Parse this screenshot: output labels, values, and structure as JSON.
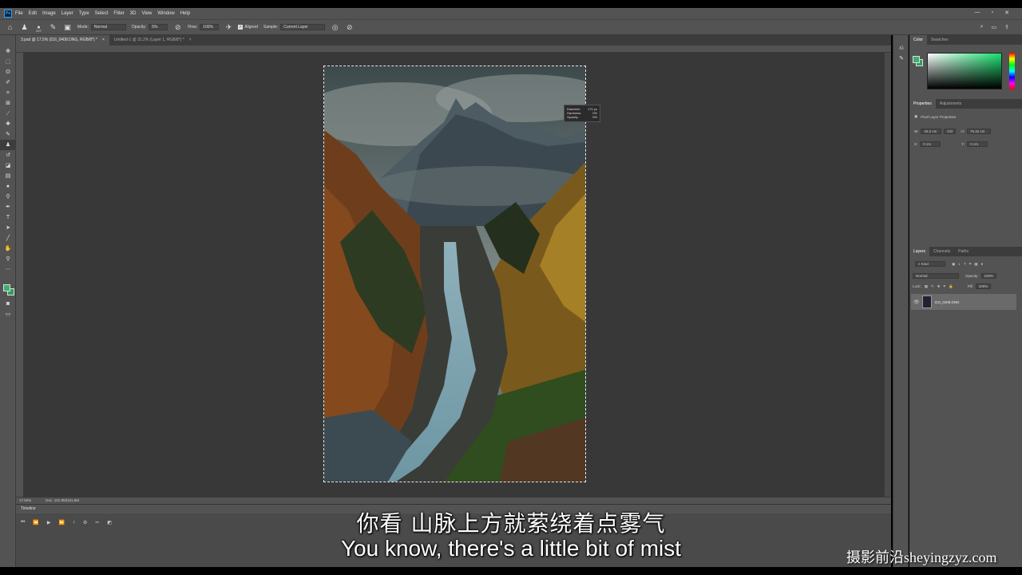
{
  "app": {
    "logo": "Ps"
  },
  "menu": [
    "File",
    "Edit",
    "Image",
    "Layer",
    "Type",
    "Select",
    "Filter",
    "3D",
    "View",
    "Window",
    "Help"
  ],
  "window_controls": [
    "—",
    "▫",
    "✕"
  ],
  "options": {
    "brush_size": "227",
    "mode_label": "Mode:",
    "mode_value": "Normal",
    "opacity_label": "Opacity:",
    "opacity_value": "5%",
    "flow_label": "Flow:",
    "flow_value": "100%",
    "aligned_label": "Aligned",
    "sample_label": "Sample:",
    "sample_value": "Current Layer"
  },
  "doc_tabs": [
    {
      "label": "3.psd @ 17.5% (DJI_0408.DNG, RGB/8*) *",
      "close": "×"
    },
    {
      "label": "Untitled-1 @ 31.2% (Layer 1, RGB/8*) *",
      "close": "×"
    }
  ],
  "brush_hud": {
    "rows": [
      {
        "k": "Diameter:",
        "v": "174 px"
      },
      {
        "k": "Hardness:",
        "v": "0%"
      },
      {
        "k": "Opacity:",
        "v": "5%"
      }
    ]
  },
  "status": {
    "zoom": "17.52%",
    "doc": "Doc: 101.9M/101.9M"
  },
  "timeline": {
    "title": "Timeline"
  },
  "panels": {
    "color_tabs": [
      "Color",
      "Swatches"
    ],
    "props_tabs": [
      "Properties",
      "Adjustments"
    ],
    "props_title": "Pixel Layer Properties",
    "props": {
      "w_label": "W:",
      "w_val": "40.2 cm",
      "link": "GO",
      "h_label": "H:",
      "h_val": "75.32 cm",
      "x_label": "X:",
      "x_val": "0 cm",
      "y_label": "Y:",
      "y_val": "0 cm"
    },
    "layers_tabs": [
      "Layers",
      "Channels",
      "Paths"
    ],
    "layers_kind": "Kind",
    "layers_blend": "Normal",
    "layers_opacity_label": "Opacity:",
    "layers_opacity_value": "100%",
    "layers_lock_label": "Lock:",
    "layers_fill_label": "Fill:",
    "layers_fill_value": "100%",
    "layer_name": "DJI_0408.DNG"
  },
  "colors": {
    "fg": "#3fae6f",
    "bg": "#2e9e5f",
    "panel": "#535353",
    "canvas": "#383838"
  },
  "subtitles": {
    "cn": "你看 山脉上方就萦绕着点雾气",
    "en": "You know, there's a little bit of mist"
  },
  "watermark": "摄影前沿sheyingzyz.com"
}
